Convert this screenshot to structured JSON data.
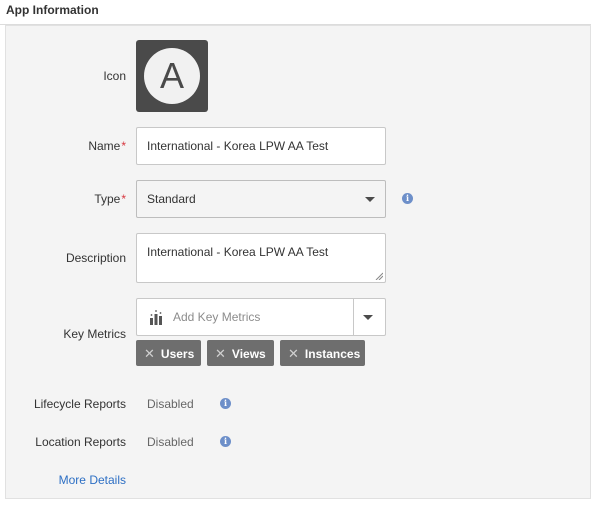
{
  "section": {
    "title": "App Information"
  },
  "form": {
    "icon": {
      "label": "Icon",
      "letter": "A"
    },
    "name": {
      "label": "Name",
      "required_marker": "*",
      "value": "International - Korea LPW AA Test"
    },
    "type": {
      "label": "Type",
      "required_marker": "*",
      "value": "Standard"
    },
    "description": {
      "label": "Description",
      "value": "International - Korea LPW AA Test"
    },
    "key_metrics": {
      "label": "Key Metrics",
      "placeholder": "Add Key Metrics",
      "tags": [
        "Users",
        "Views",
        "Instances"
      ],
      "remove_glyph": "✕"
    },
    "lifecycle_reports": {
      "label": "Lifecycle Reports",
      "value": "Disabled"
    },
    "location_reports": {
      "label": "Location Reports",
      "value": "Disabled"
    },
    "more_details": {
      "label": "More Details"
    }
  },
  "icons": {
    "info": "info-icon",
    "dropdown": "chevron-down-icon",
    "metrics": "bar-chart-icon",
    "remove": "close-icon"
  },
  "colors": {
    "accent": "#2d6fc4",
    "required": "#d7373f",
    "info": "#6d8fc9",
    "tag_bg": "#6e6e6e",
    "icon_tile": "#4a4a4a"
  }
}
